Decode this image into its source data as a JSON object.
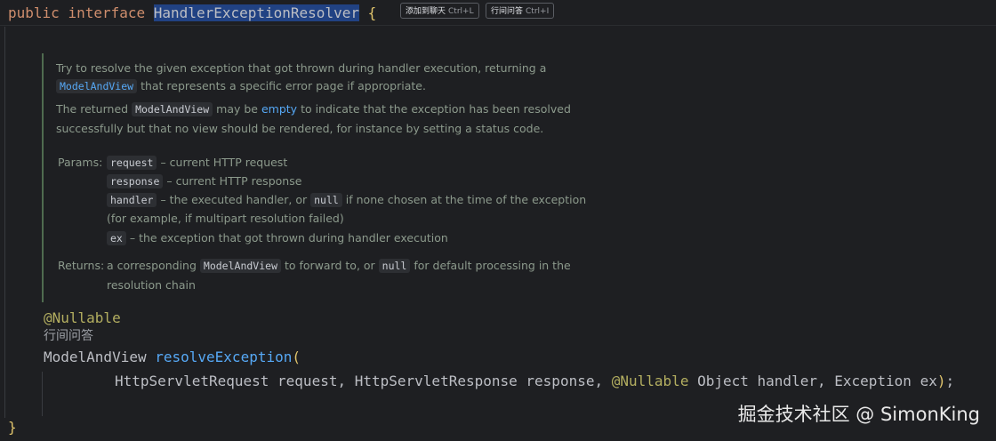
{
  "code": {
    "line1": {
      "kw_public": "public",
      "kw_interface": "interface",
      "type_name": "HandlerExceptionResolver",
      "open_brace": "{"
    },
    "annotation": "@Nullable",
    "inlay_hint": "行间问答",
    "return_type": "ModelAndView",
    "method_name": "resolveException",
    "open_paren": "(",
    "params": {
      "t1": "HttpServletRequest",
      "n1": "request,",
      "t2": "HttpServletResponse",
      "n2": "response,",
      "ann": "@Nullable",
      "t3": "Object",
      "n3": "handler,",
      "t4": "Exception",
      "n4": "ex",
      "close_paren": ")",
      "semicolon": ";"
    },
    "close_brace": "}"
  },
  "inline_actions": [
    {
      "label": "添加到聊天",
      "shortcut": "Ctrl+L"
    },
    {
      "label": "行间问答",
      "shortcut": "Ctrl+I"
    }
  ],
  "doc": {
    "p1_a": "Try to resolve the given exception that got thrown during handler execution, returning a",
    "p1_code": "ModelAndView",
    "p1_b": "that represents a specific error page if appropriate.",
    "p2_a": "The returned",
    "p2_code": "ModelAndView",
    "p2_b": "may be",
    "p2_link": "empty",
    "p2_c": "to indicate that the exception has been resolved",
    "p2_d": "successfully but that no view should be rendered, for instance by setting a status code.",
    "params_label": "Params:",
    "params": [
      {
        "name": "request",
        "desc": "– current HTTP request"
      },
      {
        "name": "response",
        "desc": "– current HTTP response"
      },
      {
        "name": "handler",
        "desc_a": "– the executed handler, or",
        "code": "null",
        "desc_b": "if none chosen at the time of the exception",
        "desc_c": "(for example, if multipart resolution failed)"
      },
      {
        "name": "ex",
        "desc": "– the exception that got thrown during handler execution"
      }
    ],
    "returns_label": "Returns:",
    "returns_a": "a corresponding",
    "returns_code": "ModelAndView",
    "returns_b": "to forward to, or",
    "returns_code2": "null",
    "returns_c": "for default processing in the",
    "returns_d": "resolution chain"
  },
  "watermark": "掘金技术社区 @ SimonKing",
  "colors": {
    "background": "#1e1f22",
    "keyword": "#cf8e6d",
    "selection": "#214283",
    "annotation": "#b3ae60",
    "method": "#56a8f5",
    "doc_text": "#8c9a8c",
    "doc_border": "#4f6b4f"
  }
}
